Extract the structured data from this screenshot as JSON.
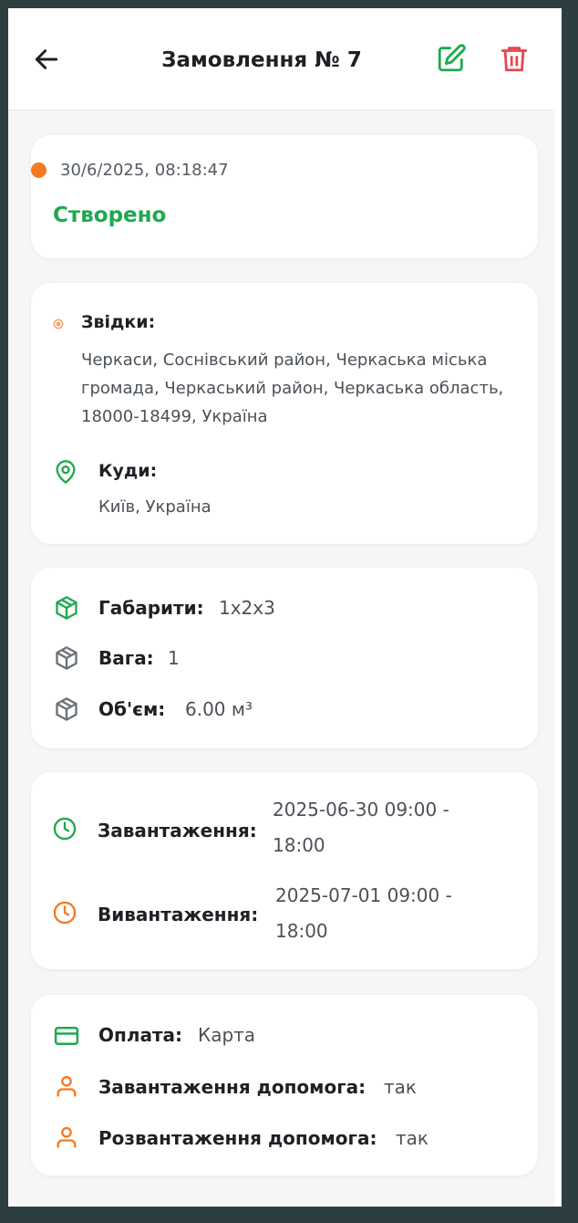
{
  "header": {
    "title": "Замовлення № 7"
  },
  "status_card": {
    "date": "30/6/2025, 08:18:47",
    "status": "Створено",
    "status_color": "#1fa84f",
    "dot_color": "#f47a20"
  },
  "route": {
    "from_label": "Звідки:",
    "from_address": "Черкаси, Соснівський район, Черкаська міська громада, Черкаський район, Черкаська область, 18000-18499, Україна",
    "to_label": "Куди:",
    "to_address": "Київ, Україна"
  },
  "cargo": {
    "dimensions_label": "Габарити:",
    "dimensions_value": "1x2x3",
    "weight_label": "Вага:",
    "weight_value": "1",
    "volume_label": "Об'єм:",
    "volume_value": "6.00 м³"
  },
  "schedule": {
    "loading_label": "Завантаження:",
    "loading_line1": "2025-06-30 09:00 -",
    "loading_line2": "18:00",
    "unloading_label": "Вивантаження:",
    "unloading_line1": "2025-07-01 09:00 -",
    "unloading_line2": "18:00"
  },
  "extras": {
    "payment_label": "Оплата:",
    "payment_value": "Карта",
    "loading_help_label": "Завантаження допомога:",
    "loading_help_value": "так",
    "unloading_help_label": "Розвантаження допомога:",
    "unloading_help_value": "так"
  },
  "colors": {
    "accent_green": "#1fa84f",
    "accent_orange": "#f47a20",
    "danger_red": "#e5484d",
    "icon_gray": "#6b7178"
  },
  "icons": [
    "arrow-left-icon",
    "edit-icon",
    "trash-icon",
    "map-pin-icon",
    "box-icon",
    "clock-icon",
    "credit-card-icon",
    "user-icon"
  ]
}
